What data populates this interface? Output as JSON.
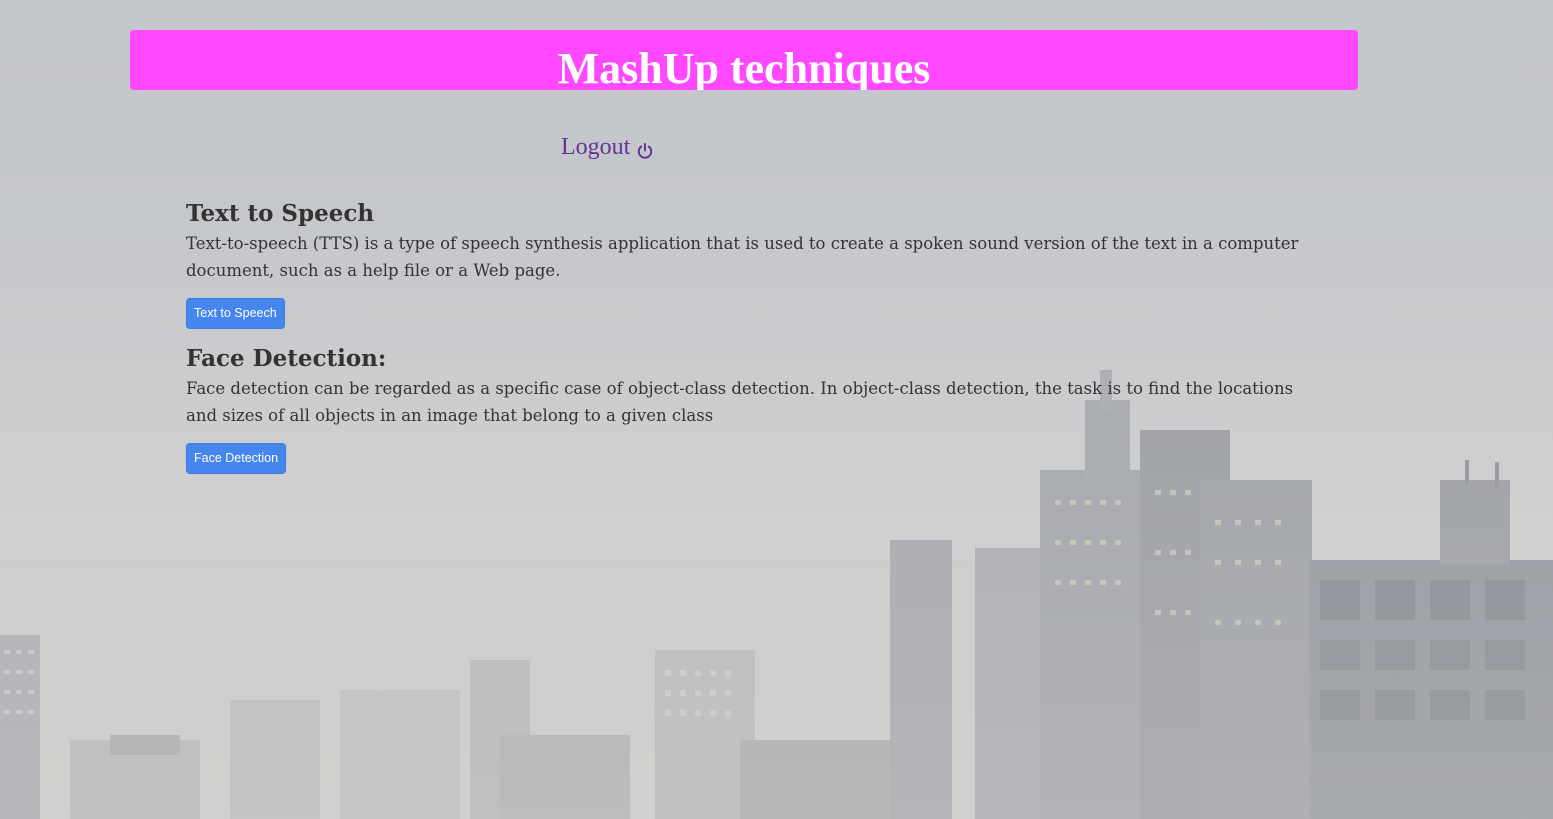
{
  "header": {
    "title": "MashUp techniques",
    "background_color": "#ff48ff"
  },
  "nav": {
    "logout_label": "Logout",
    "logout_icon": "power-icon",
    "link_color": "#663399"
  },
  "sections": [
    {
      "heading": "Text to Speech",
      "description": "Text-to-speech (TTS) is a type of speech synthesis application that is used to create a spoken sound version of the text in a computer document, such as a help file or a Web page.",
      "button_label": "Text to Speech"
    },
    {
      "heading": "Face Detection:",
      "description": "Face detection can be regarded as a specific case of object-class detection. In object-class detection, the task is to find the locations and sizes of all objects in an image that belong to a given class",
      "button_label": "Face Detection"
    }
  ],
  "colors": {
    "button_bg": "#4486ee",
    "text": "#333333"
  }
}
